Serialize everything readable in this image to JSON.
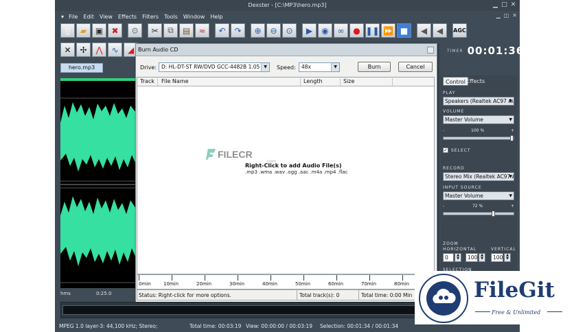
{
  "window": {
    "title": "Dexster - [C:\\MP3\\hero.mp3]"
  },
  "menu": [
    "File",
    "Edit",
    "View",
    "Effects",
    "Filters",
    "Tools",
    "Window",
    "Help"
  ],
  "timer": {
    "label": "TIMER",
    "value": "00:01:36"
  },
  "file_tab": "hero.mp3",
  "ruler": {
    "unit": "hms",
    "mark": "0:25.0"
  },
  "toolbar": {
    "agc_label": "AGC"
  },
  "dialog": {
    "title": "Burn Audio CD",
    "drive_label": "Drive:",
    "drive_value": "D: HL-DT-ST RW/DVD GCC-4482B 1.05",
    "speed_label": "Speed:",
    "speed_value": "48x",
    "burn_label": "Burn",
    "cancel_label": "Cancel",
    "columns": [
      "Track",
      "File Name",
      "Length",
      "Size"
    ],
    "hint": "Right-Click to add Audio File(s)",
    "formats": ".mp3 .wma .wav .ogg .aac .m4a .mp4 .flac",
    "watermark": "FILECR",
    "watermark_sub": ".com",
    "timeline": [
      "0min",
      "10min",
      "20min",
      "30min",
      "40min",
      "50min",
      "60min",
      "70min",
      "80min"
    ],
    "status": "Status: Right-click for more options.",
    "total_tracks": "Total track(s): 0",
    "total_time": "Total time: 0:00 Min"
  },
  "panel": {
    "tabs": [
      "Control",
      "Effects"
    ],
    "play_label": "PLAY",
    "play_device": "Speakers (Realtek AC97 Au",
    "volume_label": "VOLUME",
    "volume_source": "Master Volume",
    "volume_percent": "100 %",
    "volume_level": 1.0,
    "select_label": "SELECT",
    "record_label": "RECORD",
    "record_device": "Stereo Mix (Realtek AC97 A",
    "input_label": "INPUT SOURCE",
    "input_source": "Master Volume",
    "input_percent": "72 %",
    "input_level": 0.72,
    "zoom_label": "ZOOM",
    "horizontal_label": "HORIZONTAL",
    "vertical_label": "VERTICAL",
    "zoom_h_min": "0",
    "zoom_h": "100",
    "zoom_v": "100",
    "selection_label": "SELECTION"
  },
  "statusbar": {
    "format": "MPEG 1.0 layer-3: 44,100 kHz; Stereo;",
    "total_time": "Total time: 00:03:19",
    "view": "View: 00:00:00 / 00:03:19",
    "selection": "Selection: 00:01:34 / 00:01:34"
  },
  "badge": {
    "name": "FileGit",
    "tagline": "Free & Unlimited"
  },
  "colors": {
    "waveform": "#36e0a0",
    "app_bg": "#3f4b56",
    "brand": "#1f3d73"
  }
}
